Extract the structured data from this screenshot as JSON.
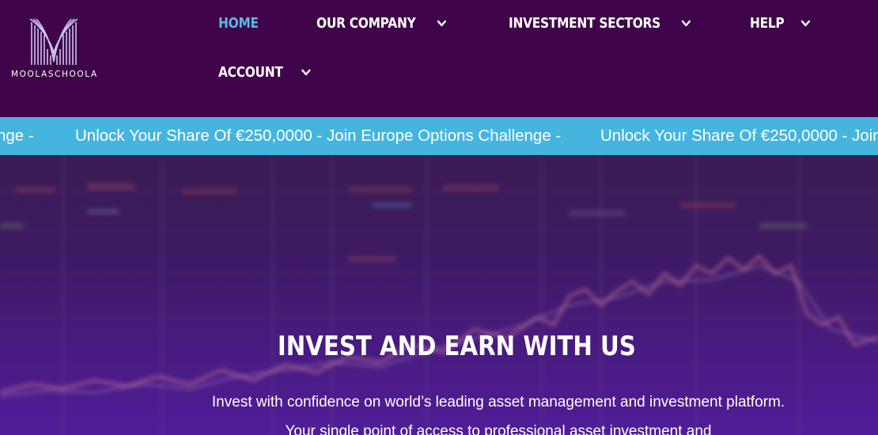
{
  "brand": {
    "name": "MOOLASCHOOLA"
  },
  "nav": {
    "items": [
      {
        "label": "HOME",
        "active": true,
        "dropdown": false
      },
      {
        "label": "OUR COMPANY",
        "active": false,
        "dropdown": true
      },
      {
        "label": "INVESTMENT SECTORS",
        "active": false,
        "dropdown": true
      },
      {
        "label": "HELP",
        "active": false,
        "dropdown": true
      },
      {
        "label": "ACCOUNT",
        "active": false,
        "dropdown": true
      }
    ]
  },
  "ticker": {
    "segments": [
      "nge -",
      "Unlock Your Share Of €250,0000 - Join Europe Options Challenge -",
      "Unlock Your Share Of €250,0000 - Join"
    ]
  },
  "hero": {
    "title": "INVEST AND EARN WITH US",
    "description": "Invest with confidence on world’s leading asset management and investment platform. Your single point of access to professional asset investment and"
  },
  "colors": {
    "header_bg": "#3f044a",
    "accent": "#5bb8e4",
    "ticker_bg": "#45b5e0",
    "text": "#ffffff"
  },
  "icons": {
    "logo": "stylized-m-lines-logo",
    "dropdown": "chevron-down-icon"
  }
}
